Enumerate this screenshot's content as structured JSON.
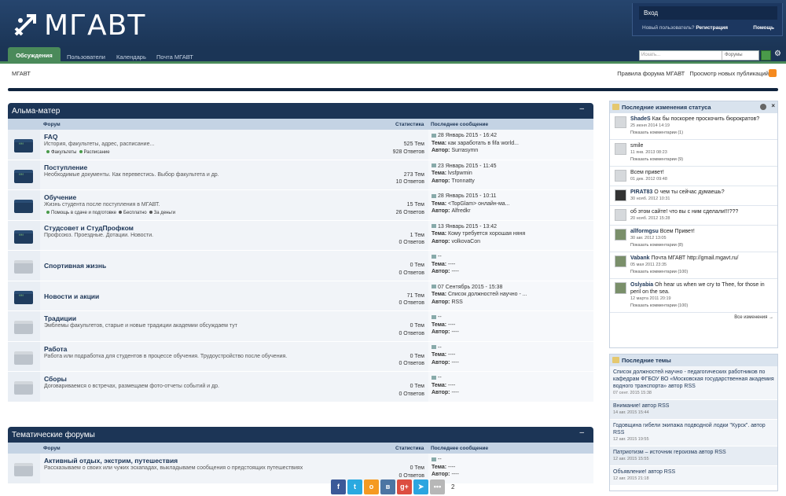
{
  "header": {
    "logo_text": "МГАВТ",
    "login": "Вход",
    "new_user_q": "Новый пользователь?",
    "register": "Регистрация",
    "help": "Помощь"
  },
  "nav": {
    "tabs": [
      "Обсуждения",
      "Пользователи",
      "Календарь",
      "Почта МГАВТ"
    ],
    "search_placeholder": "Искать...",
    "search_scope": "Форумы"
  },
  "breadcrumb": {
    "home": "МГАВТ",
    "rules": "Правила форума МГАВТ",
    "new_posts": "Просмотр новых публикаций"
  },
  "columns": {
    "forum": "Форум",
    "stats": "Статистика",
    "last": "Последнее сообщение"
  },
  "sections": [
    {
      "title": "Альма-матер",
      "forums": [
        {
          "title": "FAQ",
          "desc": "История, факультеты, адрес, расписание...",
          "subs": [
            "Факультеты",
            "Расписание"
          ],
          "topics": "525 Тем",
          "replies": "928 Ответов",
          "date": "28 Январь 2015 - 16:42",
          "topic_label": "Тема:",
          "topic": "как заработать в fifa world...",
          "author_label": "Автор:",
          "author": "Surrasymn",
          "icon": "chat"
        },
        {
          "title": "Поступление",
          "desc": "Необходимые документы. Как перевестись. Выбор факультета и др.",
          "subs": [],
          "topics": "273 Тем",
          "replies": "10 Ответов",
          "date": "23 Январь 2015 - 11:45",
          "topic_label": "Тема:",
          "topic": "lvsfpwmin",
          "author_label": "Автор:",
          "author": "Tronnatty",
          "icon": "chat"
        },
        {
          "title": "Обучение",
          "desc": "Жизнь студента после поступления в МГАВТ.",
          "subs": [
            "Помощь в сдаче и подготовке",
            "Бесплатно",
            "За деньги"
          ],
          "topics": "15 Тем",
          "replies": "26 Ответов",
          "date": "28 Январь 2015 - 10:11",
          "topic_label": "Тема:",
          "topic": "<TopGlam> онлайн-ма...",
          "author_label": "Автор:",
          "author": "Alfredkr",
          "icon": "on"
        },
        {
          "title": "Студсовет и СтудПрофком",
          "desc": "Профсоюз. Проездные. Дотации. Новости.",
          "subs": [],
          "topics": "1 Тем",
          "replies": "0 Ответов",
          "date": "13 Январь 2015 - 13:42",
          "topic_label": "Тема:",
          "topic": "Кому требуется хорошая няня",
          "author_label": "Автор:",
          "author": "volkovaCon",
          "icon": "chat"
        },
        {
          "title": "Спортивная жизнь",
          "desc": "",
          "subs": [],
          "topics": "0 Тем",
          "replies": "0 Ответов",
          "date": "--",
          "topic_label": "Тема:",
          "topic": "----",
          "author_label": "Автор:",
          "author": "----",
          "icon": "off"
        },
        {
          "title": "Новости и акции",
          "desc": "",
          "subs": [],
          "topics": "71 Тем",
          "replies": "0 Ответов",
          "date": "07 Сентябрь 2015 - 15:38",
          "topic_label": "Тема:",
          "topic": "Список должностей научно - ...",
          "author_label": "Автор:",
          "author": "RSS",
          "icon": "chat"
        },
        {
          "title": "Традиции",
          "desc": "Эмблемы факультетов, старые и новые традиции академии обсуждаем тут",
          "subs": [],
          "topics": "0 Тем",
          "replies": "0 Ответов",
          "date": "--",
          "topic_label": "Тема:",
          "topic": "----",
          "author_label": "Автор:",
          "author": "----",
          "icon": "off"
        },
        {
          "title": "Работа",
          "desc": "Работа или подработка для студентов в процессе обучения. Трудоустройство после обучения.",
          "subs": [],
          "topics": "0 Тем",
          "replies": "0 Ответов",
          "date": "--",
          "topic_label": "Тема:",
          "topic": "----",
          "author_label": "Автор:",
          "author": "----",
          "icon": "off"
        },
        {
          "title": "Сборы",
          "desc": "Договариваемся о встречах, размещаем фото-отчеты событий и др.",
          "subs": [],
          "topics": "0 Тем",
          "replies": "0 Ответов",
          "date": "--",
          "topic_label": "Тема:",
          "topic": "----",
          "author_label": "Автор:",
          "author": "----",
          "icon": "off"
        }
      ]
    },
    {
      "title": "Тематические форумы",
      "forums": [
        {
          "title": "Активный отдых, экстрим, путешествия",
          "desc": "Рассказываем о своих или чужих эскападах, выкладываем сообщения о предстоящих путешествиях",
          "subs": [],
          "topics": "0 Тем",
          "replies": "0 Ответов",
          "date": "--",
          "topic_label": "Тема:",
          "topic": "----",
          "author_label": "Автор:",
          "author": "----",
          "icon": "off"
        }
      ]
    }
  ],
  "sidebar": {
    "status_title": "Последние изменения статуса",
    "statuses": [
      {
        "who": "ShadeS",
        "text": "Как бы поскорее проскочить бюрократов?",
        "meta": "25 июня 2014 14:19",
        "more": "Показать комментарии (1)",
        "av": "plain"
      },
      {
        "who": "",
        "text": "smile",
        "meta": "11 янв. 2013 08:23",
        "more": "Показать комментарии (9)",
        "av": "plain"
      },
      {
        "who": "",
        "text": "Всем привет!",
        "meta": "01 дек. 2012 09:48",
        "more": "",
        "av": "plain"
      },
      {
        "who": "PIRAT83",
        "text": "О чем ты сейчас думаешь?",
        "meta": "30 нояб. 2012 10:31",
        "more": "",
        "av": "dark"
      },
      {
        "who": "",
        "text": "об этом сайте! что вы с ним сделали!!!???",
        "meta": "20 нояб. 2012 15:28",
        "more": "",
        "av": "plain"
      },
      {
        "who": "allformgsu",
        "text": "Всем Привет!",
        "meta": "30 авг. 2012 13:05",
        "more": "Показать комментарии (8)",
        "av": "photo"
      },
      {
        "who": "Vabank",
        "text": "Почта МГАВТ http://gmail.mgavt.ru/",
        "meta": "05 мая 2011 23:35",
        "more": "Показать комментарии (100)",
        "av": "photo"
      },
      {
        "who": "Oslyabia",
        "text": "Oh hear us when we cry to Thee, for those in peril on the sea.",
        "meta": "12 марта 2011 20:19",
        "more": "Показать комментарии (100)",
        "av": "photo"
      }
    ],
    "more_link": "Все изменения →",
    "topics_title": "Последние темы",
    "topics": [
      {
        "text": "Список должностей научно - педагогических работников по кафедрам ФГБОУ ВО «Московская государственная академия водного транспорта» автор RSS",
        "meta": "07 сент. 2015 15:38"
      },
      {
        "text": "Внимание! автор RSS",
        "meta": "14 авг. 2015 15:44"
      },
      {
        "text": "Годовщина гибели экипажа подводной лодки \"Курск\". автор RSS",
        "meta": "12 авг. 2015 19:55"
      },
      {
        "text": "Патриотизм – источник героизма автор RSS",
        "meta": "12 авг. 2015 15:55"
      },
      {
        "text": "Объявление! автор RSS",
        "meta": "12 авг. 2015 21:18"
      }
    ]
  },
  "share": {
    "buttons": [
      {
        "icon": "facebook-icon",
        "glyph": "f",
        "color": "#3b5998"
      },
      {
        "icon": "twitter-icon",
        "glyph": "t",
        "color": "#2aa9e0"
      },
      {
        "icon": "odnoklassniki-icon",
        "glyph": "о",
        "color": "#f59a22"
      },
      {
        "icon": "vkontakte-icon",
        "glyph": "в",
        "color": "#4c75a3"
      },
      {
        "icon": "googleplus-icon",
        "glyph": "g+",
        "color": "#dc4e41"
      },
      {
        "icon": "telegram-icon",
        "glyph": "➤",
        "color": "#2ca5e0"
      },
      {
        "icon": "more-icon",
        "glyph": "•••",
        "color": "#b7b7b7"
      }
    ],
    "count": "2"
  }
}
